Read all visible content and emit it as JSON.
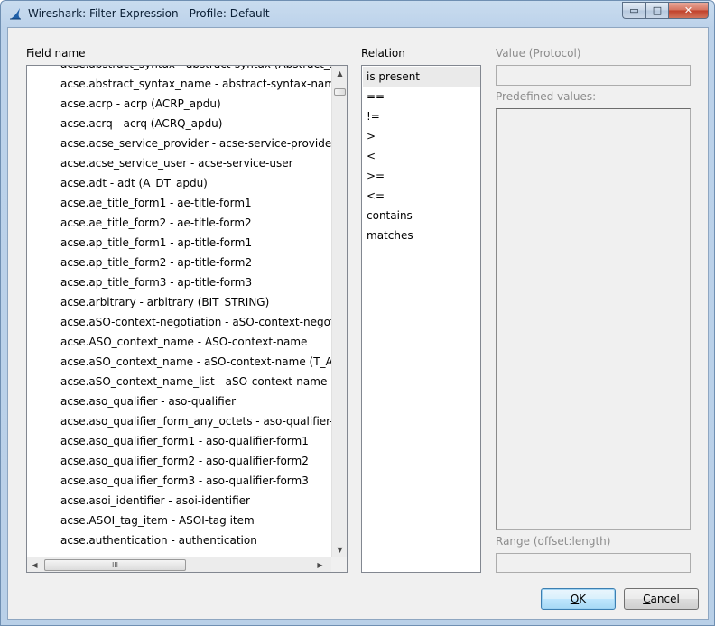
{
  "window": {
    "title": "Wireshark: Filter Expression - Profile: Default",
    "controls": {
      "minimize": "▭",
      "maximize": "□",
      "close": "✕"
    }
  },
  "labels": {
    "field_name": "Field name",
    "relation": "Relation",
    "value": "Value (Protocol)",
    "predefined": "Predefined values:",
    "range": "Range (offset:length)"
  },
  "fields": [
    "acse.abstract_syntax - abstract-syntax (Abstract_syntax_name)",
    "acse.abstract_syntax_name - abstract-syntax-name",
    "acse.acrp - acrp (ACRP_apdu)",
    "acse.acrq - acrq (ACRQ_apdu)",
    "acse.acse_service_provider - acse-service-provider",
    "acse.acse_service_user - acse-service-user",
    "acse.adt - adt (A_DT_apdu)",
    "acse.ae_title_form1 - ae-title-form1",
    "acse.ae_title_form2 - ae-title-form2",
    "acse.ap_title_form1 - ap-title-form1",
    "acse.ap_title_form2 - ap-title-form2",
    "acse.ap_title_form3 - ap-title-form3",
    "acse.arbitrary - arbitrary (BIT_STRING)",
    "acse.aSO-context-negotiation - aSO-context-negotiation",
    "acse.ASO_context_name - ASO-context-name",
    "acse.aSO_context_name - aSO-context-name (T_AARQ_aSO_context_name)",
    "acse.aSO_context_name_list - aSO-context-name-list",
    "acse.aso_qualifier - aso-qualifier",
    "acse.aso_qualifier_form_any_octets - aso-qualifier-form-any-octets",
    "acse.aso_qualifier_form1 - aso-qualifier-form1",
    "acse.aso_qualifier_form2 - aso-qualifier-form2",
    "acse.aso_qualifier_form3 - aso-qualifier-form3",
    "acse.asoi_identifier - asoi-identifier",
    "acse.ASOI_tag_item - ASOI-tag item",
    "acse.authentication - authentication"
  ],
  "relations": [
    "is present",
    "==",
    "!=",
    ">",
    "<",
    ">=",
    "<=",
    "contains",
    "matches"
  ],
  "selected_relation": "is present",
  "scroll": {
    "h_thumb_grip": "III",
    "up": "▲",
    "down": "▼",
    "left": "◀",
    "right": "▶"
  },
  "buttons": {
    "ok_accel": "O",
    "ok_rest": "K",
    "cancel_accel": "C",
    "cancel_rest": "ancel"
  }
}
